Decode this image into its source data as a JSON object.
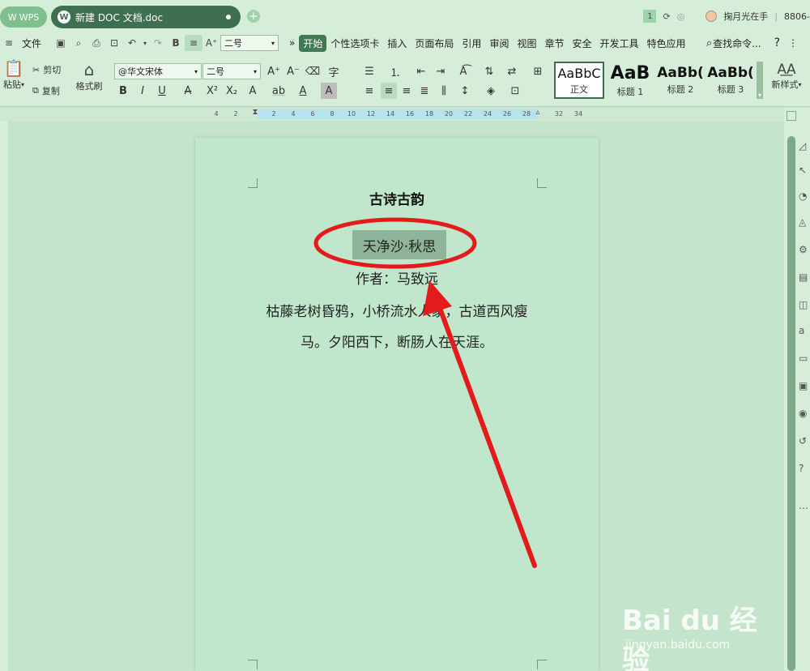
{
  "titlebar": {
    "app_tab": "WPS",
    "doc_tab": "新建 DOC 文档.doc",
    "add_tab": "+",
    "page_badge": "1",
    "user_name": "掬月光在手",
    "account_id": "8806-"
  },
  "menubar": {
    "file": "文件",
    "font_size_value": "二号",
    "more": "»",
    "tabs": [
      "开始",
      "个性选项卡",
      "插入",
      "页面布局",
      "引用",
      "审阅",
      "视图",
      "章节",
      "安全",
      "开发工具",
      "特色应用"
    ],
    "active_tab": "开始",
    "search": "查找命令...",
    "help": "?",
    "more_menu": "⋮"
  },
  "ribbon": {
    "paste": "粘贴",
    "cut": "剪切",
    "copy": "复制",
    "format_painter": "格式刷",
    "font_name": "@华文宋体",
    "font_size": "二号",
    "styles": [
      {
        "preview": "AaBbC",
        "name": "正文"
      },
      {
        "preview": "AaB",
        "name": "标题 1"
      },
      {
        "preview": "AaBb(",
        "name": "标题 2"
      },
      {
        "preview": "AaBb(",
        "name": "标题 3"
      }
    ],
    "new_style": "新样式"
  },
  "ruler": {
    "numbers": [
      "4",
      "2",
      "2",
      "4",
      "6",
      "8",
      "10",
      "12",
      "14",
      "16",
      "18",
      "20",
      "22",
      "24",
      "26",
      "28",
      "32",
      "34"
    ]
  },
  "document": {
    "title": "古诗古韵",
    "subtitle": "天净沙·秋思",
    "author": "作者：马致远",
    "lines": [
      "枯藤老树昏鸦，小桥流水人家，古道西风瘦",
      "马。夕阳西下，断肠人在天涯。"
    ]
  },
  "annotation_color": "#e31b1b",
  "watermark": {
    "main": "Bai du 经验",
    "sub": "jingyan.baidu.com"
  }
}
